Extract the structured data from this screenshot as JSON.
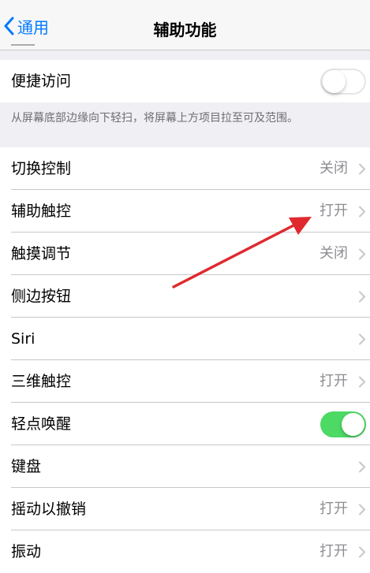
{
  "nav": {
    "back_label": "通用",
    "title": "辅助功能"
  },
  "reachability": {
    "label": "便捷访问",
    "toggle_state": "off",
    "footer": "从屏幕底部边缘向下轻扫，将屏幕上方项目拉至可及范围。"
  },
  "settings": {
    "rows": [
      {
        "label": "切换控制",
        "value": "关闭",
        "control": "chevron"
      },
      {
        "label": "辅助触控",
        "value": "打开",
        "control": "chevron"
      },
      {
        "label": "触摸调节",
        "value": "关闭",
        "control": "chevron"
      },
      {
        "label": "侧边按钮",
        "value": "",
        "control": "chevron"
      },
      {
        "label": "Siri",
        "value": "",
        "control": "chevron"
      },
      {
        "label": "三维触控",
        "value": "打开",
        "control": "chevron"
      },
      {
        "label": "轻点唤醒",
        "value": "",
        "control": "toggle",
        "toggle_state": "on"
      },
      {
        "label": "键盘",
        "value": "",
        "control": "chevron"
      },
      {
        "label": "摇动以撤销",
        "value": "打开",
        "control": "chevron"
      },
      {
        "label": "振动",
        "value": "打开",
        "control": "chevron"
      }
    ]
  },
  "colors": {
    "accent": "#007aff",
    "toggle_on": "#4cd964",
    "annotation_arrow": "#e0292e",
    "background": "#efeff4",
    "secondary_text": "#8e8e93"
  },
  "icons": {
    "back": "chevron-left-icon",
    "disclosure": "chevron-right-icon",
    "annotation": "arrow-icon"
  }
}
